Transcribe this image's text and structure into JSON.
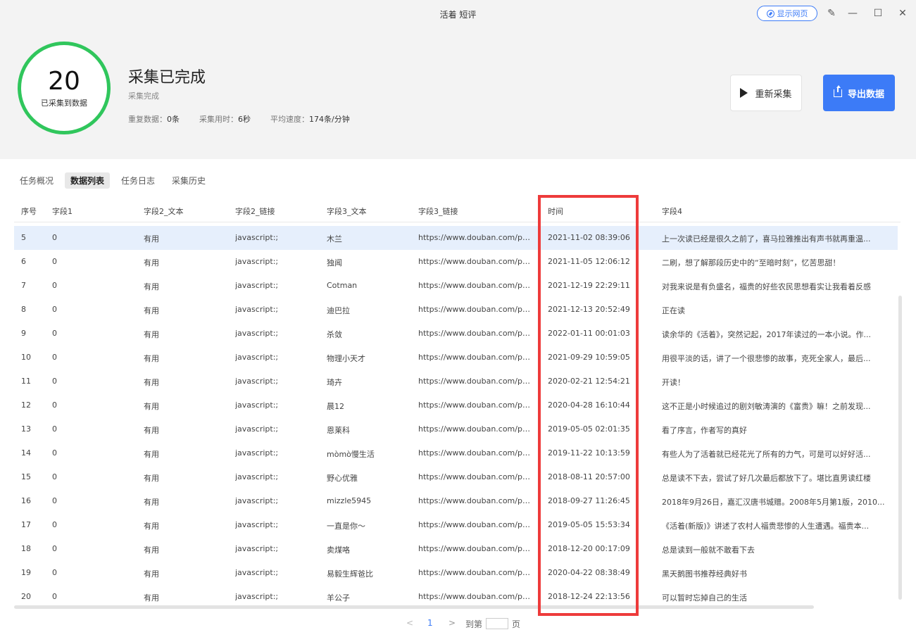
{
  "window": {
    "title": "活着 短评",
    "show_web_label": "显示网页"
  },
  "summary": {
    "count": "20",
    "count_label": "已采集到数据",
    "title": "采集已完成",
    "subtitle": "采集完成",
    "dup_label": "重复数据：",
    "dup_value": "0条",
    "time_label": "采集用时：",
    "time_value": "6秒",
    "speed_label": "平均速度：",
    "speed_value": "174条/分钟"
  },
  "actions": {
    "recollect_label": "重新采集",
    "export_label": "导出数据"
  },
  "tabs": [
    {
      "label": "任务概况"
    },
    {
      "label": "数据列表"
    },
    {
      "label": "任务日志"
    },
    {
      "label": "采集历史"
    }
  ],
  "table": {
    "columns": [
      "序号",
      "字段1",
      "字段2_文本",
      "字段2_链接",
      "字段3_文本",
      "字段3_链接",
      "时间",
      "字段4"
    ],
    "rows": [
      [
        "5",
        "0",
        "有用",
        "javascript:;",
        "木兰",
        "https://www.douban.com/pe...",
        "2021-11-02 08:39:06",
        "上一次读已经是很久之前了，喜马拉雅推出有声书就再重温..."
      ],
      [
        "6",
        "0",
        "有用",
        "javascript:;",
        "独闻",
        "https://www.douban.com/pe...",
        "2021-11-05 12:06:12",
        "二刷，想了解那段历史中的“至暗时刻”，忆苦思甜！"
      ],
      [
        "7",
        "0",
        "有用",
        "javascript:;",
        "Cotman",
        "https://www.douban.com/pe...",
        "2021-12-19 22:29:11",
        "对我来说是有负盛名，福贵的好些农民思想看实让我看着反感"
      ],
      [
        "8",
        "0",
        "有用",
        "javascript:;",
        "迪巴拉",
        "https://www.douban.com/pe...",
        "2021-12-13 20:52:49",
        "正在读"
      ],
      [
        "9",
        "0",
        "有用",
        "javascript:;",
        "杀敛",
        "https://www.douban.com/pe...",
        "2022-01-11 00:01:03",
        "读余华的《活着》，突然记起，2017年读过的一本小说。作..."
      ],
      [
        "10",
        "0",
        "有用",
        "javascript:;",
        "物理小天才",
        "https://www.douban.com/pe...",
        "2021-09-29 10:59:05",
        "用很平淡的话，讲了一个很悲惨的故事，克死全家人，最后..."
      ],
      [
        "11",
        "0",
        "有用",
        "javascript:;",
        "琦卉",
        "https://www.douban.com/pe...",
        "2020-02-21 12:54:21",
        "开读！"
      ],
      [
        "12",
        "0",
        "有用",
        "javascript:;",
        "晨12",
        "https://www.douban.com/pe...",
        "2020-04-28 16:10:44",
        "这不正是小时候追过的剧刘敏涛演的《富贵》嘛！之前发现..."
      ],
      [
        "13",
        "0",
        "有用",
        "javascript:;",
        "恩莱科",
        "https://www.douban.com/pe...",
        "2019-05-05 02:01:35",
        "看了序言，作者写的真好"
      ],
      [
        "14",
        "0",
        "有用",
        "javascript:;",
        "mòmò慢生活",
        "https://www.douban.com/pe...",
        "2019-11-22 10:13:59",
        "有些人为了活着就已经花光了所有的力气，可是可以好好活..."
      ],
      [
        "15",
        "0",
        "有用",
        "javascript:;",
        "野心优雅",
        "https://www.douban.com/pe...",
        "2018-08-11 20:57:00",
        "总是读不下去，尝试了好几次最后都放下了。堪比直男读红楼"
      ],
      [
        "16",
        "0",
        "有用",
        "javascript:;",
        "mizzle5945",
        "https://www.douban.com/pe...",
        "2018-09-27 11:26:45",
        "2018年9月26日，嘉汇汉唐书城赠。2008年5月第1版，2010..."
      ],
      [
        "17",
        "0",
        "有用",
        "javascript:;",
        "一直是你～",
        "https://www.douban.com/pe...",
        "2019-05-05 15:53:34",
        "《活着(新版)》讲述了农村人福贵悲惨的人生遭遇。福贵本..."
      ],
      [
        "18",
        "0",
        "有用",
        "javascript:;",
        "卖煤咯",
        "https://www.douban.com/pe...",
        "2018-12-20 00:17:09",
        "总是读到一般就不敢看下去"
      ],
      [
        "19",
        "0",
        "有用",
        "javascript:;",
        "易毅生辉爸比",
        "https://www.douban.com/pe...",
        "2020-04-22 08:38:49",
        "黑天鹅图书推荐经典好书"
      ],
      [
        "20",
        "0",
        "有用",
        "javascript:;",
        "羊公子",
        "https://www.douban.com/pe...",
        "2018-12-24 22:13:56",
        "可以暂时忘掉自己的生活"
      ]
    ]
  },
  "pager": {
    "prev": "<",
    "current": "1",
    "next": ">",
    "goto_label": "到第",
    "unit": "页"
  },
  "colors": {
    "accent": "#3c7bf7",
    "success_ring": "#30c65c",
    "highlight": "#ee3b3b",
    "selected_row": "#e6effc"
  }
}
